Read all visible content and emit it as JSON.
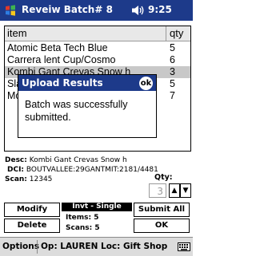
{
  "titlebar": {
    "title": "Reveiw  Batch# 8",
    "time": "9:25",
    "windows_icon": "windows-flag-icon",
    "volume_icon": "speaker-icon"
  },
  "list": {
    "columns": [
      "item",
      "qty"
    ],
    "rows": [
      {
        "name": "Atomic Beta Tech Blue",
        "qty": "5"
      },
      {
        "name": "Carrera lent Cup/Cosmo",
        "qty": "6"
      },
      {
        "name": "Kombi Gant Crevas Snow h",
        "qty": "3"
      },
      {
        "name": "Slant S",
        "qty": "5"
      },
      {
        "name": "Mouse",
        "qty": "7"
      }
    ],
    "selected_index": 2
  },
  "dialog": {
    "title": "Upload Results",
    "ok_label": "ok",
    "message": "Batch was successfully submitted."
  },
  "detail": {
    "desc_label": "Desc:",
    "desc_value": "Kombi Gant Crevas Snow h",
    "dci_label": "DCI:",
    "dci_value": "BOUTVALLEE:29GANTMIT:2181/4481",
    "scan_label": "Scan:",
    "scan_value": "12345",
    "qty_label": "Qty:",
    "qty_value": "3"
  },
  "buttons": {
    "modify": "Modify",
    "delete": "Delete",
    "submit_all": "Submit All",
    "ok": "OK"
  },
  "status": {
    "header": "Invt - Single",
    "items_label": "Items:",
    "items_value": "5",
    "scans_label": "Scans:",
    "scans_value": "5"
  },
  "bottombar": {
    "options": "Options",
    "info": "Op: LAUREN  Loc: Gift Shop",
    "keyboard_icon": "keyboard-icon"
  },
  "colors": {
    "titlebar": "#1d3a8a",
    "selected_row": "#c8c8c8",
    "bottombar": "#dcdcdc"
  }
}
